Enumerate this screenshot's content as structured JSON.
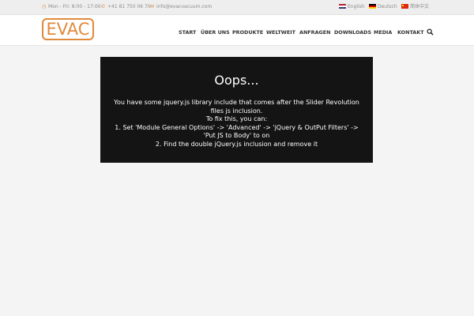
{
  "topbar": {
    "hours": "Mon - Fri: 8:00 - 17:00",
    "phone": "+41 81 750 06 70",
    "email": "info@evacvacuum.com",
    "languages": [
      {
        "label": "English"
      },
      {
        "label": "Deutsch"
      },
      {
        "label": "简体中文"
      }
    ]
  },
  "header": {
    "logo_text": "EVAC",
    "nav": [
      "START",
      "ÜBER UNS",
      "PRODUKTE",
      "WELTWEIT",
      "ANFRAGEN",
      "DOWNLOADS",
      "MEDIA",
      "KONTAKT"
    ]
  },
  "error": {
    "title": "Oops...",
    "line1": "You have some jquery.js library include that comes after the Slider Revolution files js inclusion.",
    "line2": "To fix this, you can:",
    "line3": "1. Set 'Module General Options' -> 'Advanced' -> 'jQuery & OutPut Filters' -> 'Put JS to Body' to on",
    "line4": "2. Find the double jQuery.js inclusion and remove it"
  },
  "colors": {
    "accent": "#e08a3c",
    "error_bg": "#141414",
    "page_bg": "#f4f4f4"
  }
}
